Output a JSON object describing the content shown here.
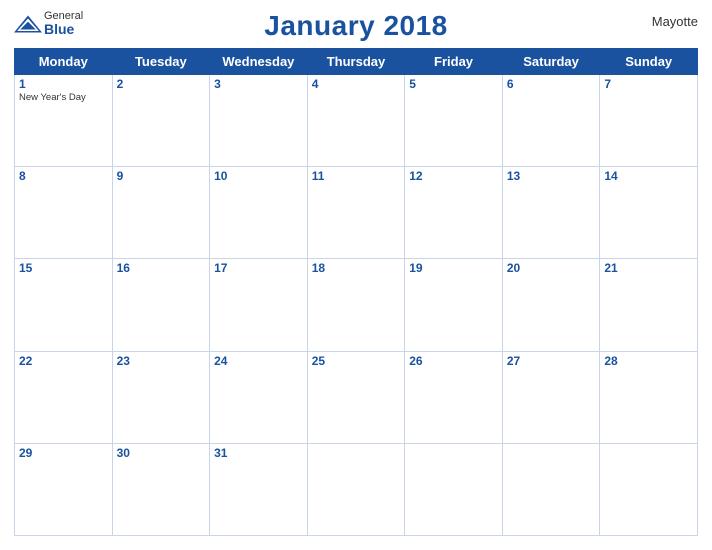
{
  "header": {
    "title": "January 2018",
    "region": "Mayotte",
    "logo_general": "General",
    "logo_blue": "Blue"
  },
  "days_of_week": [
    "Monday",
    "Tuesday",
    "Wednesday",
    "Thursday",
    "Friday",
    "Saturday",
    "Sunday"
  ],
  "weeks": [
    [
      {
        "day": 1,
        "holiday": "New Year's Day"
      },
      {
        "day": 2
      },
      {
        "day": 3
      },
      {
        "day": 4
      },
      {
        "day": 5
      },
      {
        "day": 6
      },
      {
        "day": 7
      }
    ],
    [
      {
        "day": 8
      },
      {
        "day": 9
      },
      {
        "day": 10
      },
      {
        "day": 11
      },
      {
        "day": 12
      },
      {
        "day": 13
      },
      {
        "day": 14
      }
    ],
    [
      {
        "day": 15
      },
      {
        "day": 16
      },
      {
        "day": 17
      },
      {
        "day": 18
      },
      {
        "day": 19
      },
      {
        "day": 20
      },
      {
        "day": 21
      }
    ],
    [
      {
        "day": 22
      },
      {
        "day": 23
      },
      {
        "day": 24
      },
      {
        "day": 25
      },
      {
        "day": 26
      },
      {
        "day": 27
      },
      {
        "day": 28
      }
    ],
    [
      {
        "day": 29
      },
      {
        "day": 30
      },
      {
        "day": 31
      },
      {
        "day": null
      },
      {
        "day": null
      },
      {
        "day": null
      },
      {
        "day": null
      }
    ]
  ],
  "colors": {
    "header_bg": "#1a52a0",
    "header_text": "#ffffff",
    "title_color": "#1a52a0",
    "border_color": "#c8d4e8"
  }
}
